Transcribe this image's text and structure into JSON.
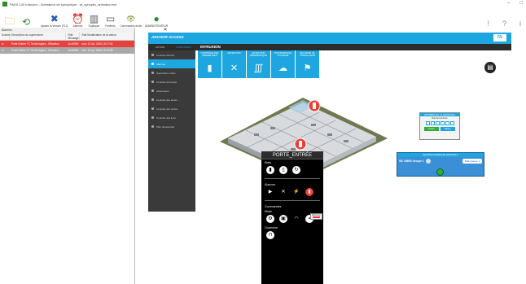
{
  "window": {
    "title": "PASS 120 Intrusion - Animateur de synoptique - at_synoptic_animator.exe",
    "controls": [
      "–",
      "□"
    ]
  },
  "toolbar": {
    "buttons": [
      {
        "label": "",
        "icon": "folder-open-icon",
        "glyph": "🗀"
      },
      {
        "label": "",
        "icon": "cycle-icon",
        "glyph": "⟲"
      },
      {
        "label": "Ajouter la Version (F12)",
        "icon": "tools-icon",
        "glyph": "✖"
      },
      {
        "label": "Alarmes",
        "icon": "alarm-clock-icon",
        "glyph": "⏰"
      },
      {
        "label": "Dupliquer",
        "icon": "window-icon",
        "glyph": "▥"
      },
      {
        "label": "Fenêtres",
        "icon": "window-single-icon",
        "glyph": "▭"
      },
      {
        "label": "Commandes école",
        "icon": "eye-icon",
        "glyph": "👁"
      },
      {
        "label": "ADMINISTRATEUR",
        "icon": "user-icon",
        "glyph": "●"
      }
    ],
    "right_icons": [
      "!",
      "?",
      "i"
    ]
  },
  "left_panel": {
    "title": "Alarmes",
    "columns": [
      "Actions",
      "Description du superviseur",
      "Etat Message",
      "Etat Modification de la valeur"
    ],
    "rows": [
      {
        "action": "✉",
        "description": "Porte Entrée TC Technologies - Effraction",
        "state": "ALARME",
        "date": "mar. 13 oct. 2020 15:17:00"
      },
      {
        "action": "✉",
        "description": "Porte Entrée TC Technologies - Effraction",
        "state": "ALARME",
        "date": "mar. 13 oct. 2020 15:16:58"
      }
    ]
  },
  "synoptic": {
    "close": "✕",
    "brand": "ANCHOR ACCESS",
    "logo": "TIL",
    "tabs": [
      "ACTION",
      "FONCTIONS"
    ],
    "menu": [
      "Contrôle d'accès",
      "Alarmes",
      "Supervision vidéo",
      "Contrôle technique",
      "Ascenseurs",
      "Contrôle des accès",
      "Contrôle des portes",
      "Contrôle des lieux",
      "Plan d'ensemble"
    ],
    "active_menu_index": 1,
    "section_title": "INTRUSION",
    "tiles": [
      {
        "label": "CONTRÔLE DES PÉRIMÈTRES",
        "glyph": "▮"
      },
      {
        "label": "DÉTECTION",
        "glyph": "✕"
      },
      {
        "label": "DÉTECTION PÉRIMÉTRIQUE",
        "glyph": "∭"
      },
      {
        "label": "TRANSMISSION D'ALARME",
        "glyph": "☁"
      },
      {
        "label": "SÉCURITÉ DU TRAVAILLEUR",
        "glyph": "⚑"
      }
    ],
    "round_button": "▤"
  },
  "widget_small": {
    "title": "ENTRÉES DE LA CENTRALE",
    "subtitle": "État des Entrées",
    "btn_on": "Activer",
    "btn_off": "Désac."
  },
  "widget_group": {
    "title": "GESTION MARCHE GROUPE 1",
    "name": "SIC GMBS Groupe 1",
    "state": "État groupe 1"
  },
  "context_panel": {
    "title": "PORTE_ENTRÉE",
    "sections": {
      "states": "Etats",
      "alarms": "Alarmes",
      "commands": "Commandes",
      "mode": "Mode",
      "opening": "Ouverture"
    },
    "tooltip": "Effraction"
  },
  "colors": {
    "accent": "#1ea6e0",
    "alarm_row": "#e8403a",
    "sidebar": "#3a3a3a",
    "context_bg": "#000000"
  }
}
